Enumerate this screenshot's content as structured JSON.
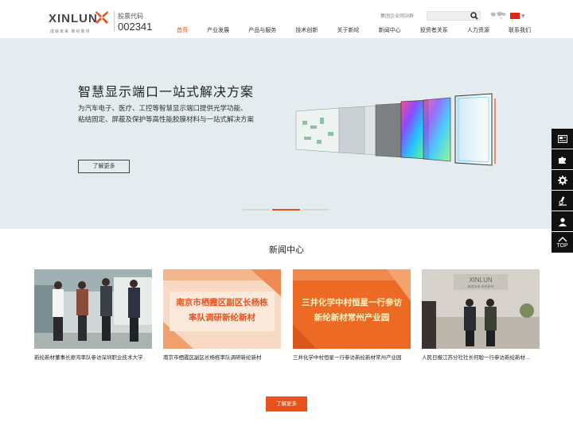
{
  "header": {
    "logo_text": "XINLUN",
    "logo_slogan": "成就未来 新纶新材",
    "stock_label": "股票代码",
    "stock_code": "002341",
    "group_sites": "集团企业网站群",
    "search_placeholder": ""
  },
  "nav": {
    "items": [
      {
        "label": "首页",
        "active": true
      },
      {
        "label": "产业发展"
      },
      {
        "label": "产品与服务"
      },
      {
        "label": "技术创新"
      },
      {
        "label": "关于新纶"
      },
      {
        "label": "新闻中心"
      },
      {
        "label": "投资者关系"
      },
      {
        "label": "人力资源"
      },
      {
        "label": "联系我们"
      }
    ]
  },
  "banner": {
    "title": "智慧显示端口一站式解决方案",
    "desc_line1": "为汽车电子、医疗、工控等智慧显示端口提供光学功能、",
    "desc_line2": "粘结固定、屏蔽及保护等高性能胶膜材料与一站式解决方案",
    "button": "了解更多"
  },
  "sidebar": {
    "top_label": "TOP"
  },
  "news": {
    "title": "新闻中心",
    "cards": [
      {
        "caption": "新纶新材董事长廖鸿率队参访深圳职业技术大学"
      },
      {
        "caption": "南京市栖霞区副区长杨栋率队调研新纶新材",
        "img_line1": "南京市栖霞区副区长杨栋",
        "img_line2": "率队调研新纶新材"
      },
      {
        "caption": "三井化学中村恒星一行参访新纶新材常州产业园",
        "img_line1": "三井化学中村恒星一行参访",
        "img_line2": "新纶新材常州产业园"
      },
      {
        "caption": "人民日报江苏分社社长何聪一行参访新纶新材…"
      }
    ],
    "more_button": "了解更多"
  },
  "colors": {
    "accent": "#e8521d",
    "banner_bg": "#e4ecef",
    "sidebar_bg": "#111111"
  }
}
